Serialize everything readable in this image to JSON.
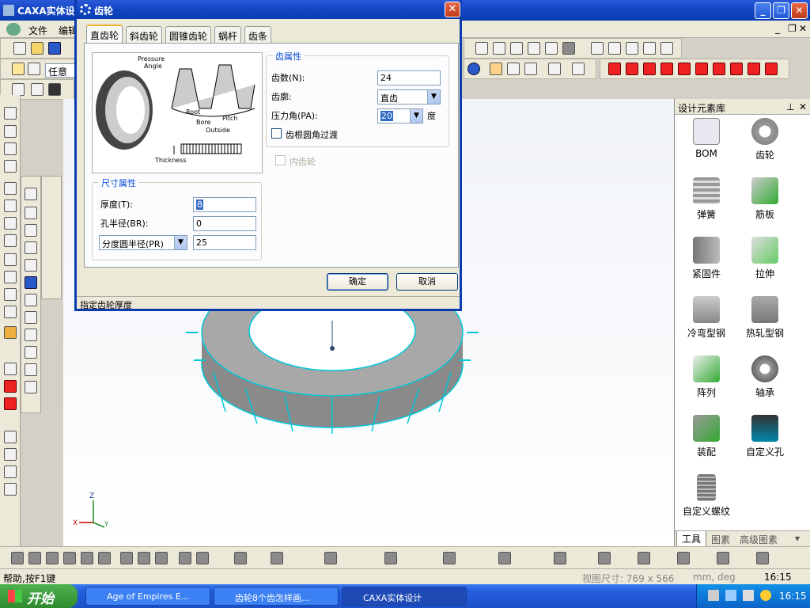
{
  "app": {
    "title": "CAXA实体设",
    "menu": [
      "文件",
      "编辑"
    ],
    "combo_value": "任意"
  },
  "panel": {
    "title": "设计元素库",
    "items": [
      "BOM",
      "齿轮",
      "弹簧",
      "筋板",
      "紧固件",
      "拉伸",
      "冷弯型钢",
      "热轧型钢",
      "阵列",
      "轴承",
      "装配",
      "自定义孔",
      "自定义螺纹"
    ],
    "tabs": [
      "工具",
      "图素",
      "高级图素"
    ]
  },
  "dialog": {
    "title": "齿轮",
    "tabs": [
      "直齿轮",
      "斜齿轮",
      "圆锥齿轮",
      "蜗杆",
      "齿条"
    ],
    "image_labels": {
      "pressure": "Pressure",
      "angle": "Angle",
      "root": "Root",
      "bore": "Bore",
      "outside": "Outside",
      "pitch": "Pitch",
      "thickness": "Thickness"
    },
    "tooth_group": {
      "legend": "齿属性",
      "teeth_label": "齿数(N):",
      "teeth_value": "24",
      "profile_label": "齿廓:",
      "profile_value": "直齿",
      "pa_label": "压力角(PA):",
      "pa_value": "20",
      "pa_unit": "度",
      "fillet_label": "齿根圆角过渡"
    },
    "internal_label": "内齿轮",
    "size_group": {
      "legend": "尺寸属性",
      "thickness_label": "厚度(T):",
      "thickness_value": "8",
      "bore_label": "孔半径(BR):",
      "bore_value": "0",
      "pitch_select": "分度圆半径(PR)",
      "pitch_value": "25"
    },
    "ok": "确定",
    "cancel": "取消",
    "status": "指定齿轮厚度"
  },
  "axes": {
    "z": "Z",
    "x": "X",
    "y": "Y"
  },
  "statusbar": {
    "help": "帮助,按F1键",
    "viewsize": "视图尺寸: 769 x 566",
    "units": "mm, deg",
    "time": "16:15"
  },
  "taskbar": {
    "start": "开始",
    "tasks": [
      "Age of Empires E...",
      "齿轮8个齿怎样画...",
      "CAXA实体设计"
    ],
    "clock": "16:15"
  },
  "colors": {
    "xp_blue": "#0a3cb0",
    "gear_edge": "#00c8d8",
    "gear_face": "#9a9a9a",
    "group_legend": "#0046d5"
  }
}
